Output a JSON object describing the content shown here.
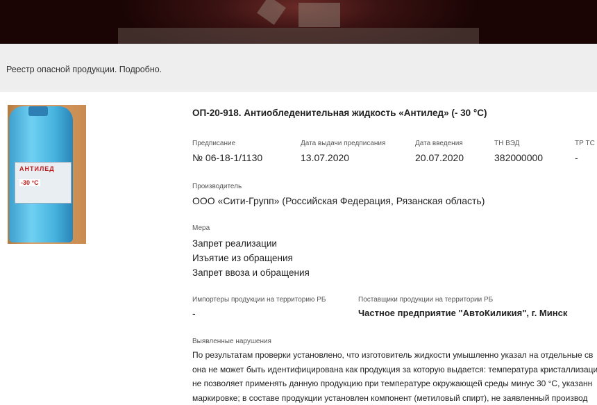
{
  "breadcrumb": {
    "text": "Реестр опасной продукции. Подробно."
  },
  "product": {
    "image_alt_brand": "АНТИЛЕД",
    "image_alt_temp": "-30 °C",
    "title": "ОП-20-918. Антиобледенительная жидкость «Антилед» (- 30 °С)"
  },
  "fields": {
    "prescription": {
      "label": "Предписание",
      "value": "№ 06-18-1/1130"
    },
    "issue_date": {
      "label": "Дата выдачи предписания",
      "value": "13.07.2020"
    },
    "intro_date": {
      "label": "Дата введения",
      "value": "20.07.2020"
    },
    "tn_ved": {
      "label": "ТН ВЭД",
      "value": "382000000"
    },
    "tr_ts": {
      "label": "ТР ТС",
      "value": "-"
    },
    "manufacturer": {
      "label": "Производитель",
      "value": "ООО «Сити-Групп» (Российская Федерация, Рязанская область)"
    },
    "measure": {
      "label": "Мера",
      "items": [
        "Запрет реализации",
        "Изъятие из обращения",
        "Запрет ввоза и обращения"
      ]
    },
    "importers": {
      "label": "Импортеры продукции на территорию РБ",
      "value": "-"
    },
    "suppliers": {
      "label": "Поставщики продукции на территории РБ",
      "value": "Частное предприятие \"АвтоКиликия\", г. Минск"
    },
    "violations": {
      "label": "Выявленные нарушения",
      "lines": [
        "По результатам проверки установлено, что изготовитель жидкости умышленно указал на отдельные св",
        "она не может быть идентифицирована как продукция за которую выдается: температура кристаллизаци",
        "не позволяет применять данную продукцию при температуре окружающей среды минус 30 °С, указанн",
        "маркировке; в составе продукции установлен компонент (метиловый спирт), не заявленный производ"
      ]
    }
  }
}
